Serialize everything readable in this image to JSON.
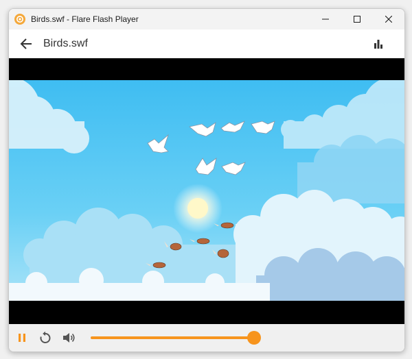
{
  "window": {
    "title": "Birds.swf - Flare Flash Player",
    "app_icon": "flare-logo-icon",
    "controls": [
      "minimize-icon",
      "maximize-icon",
      "close-icon"
    ]
  },
  "header": {
    "back_icon": "arrow-left-icon",
    "file_name": "Birds.swf",
    "stats_icon": "bar-chart-icon"
  },
  "player": {
    "content": "birds animation"
  },
  "controls": {
    "pause_icon": "pause-icon",
    "replay_icon": "replay-icon",
    "volume_icon": "volume-icon",
    "progress": 1.0
  },
  "colors": {
    "accent": "#f7941d",
    "letterbox": "#000000",
    "sky": "#4fc3f0",
    "titlebar": "#f3f3f3"
  }
}
